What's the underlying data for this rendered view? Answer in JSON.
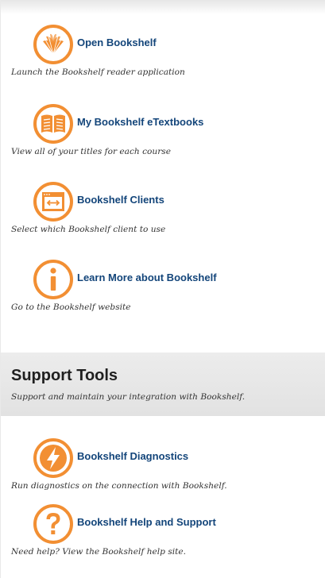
{
  "colors": {
    "icon_accent": "#f28f33",
    "link": "#13457a",
    "section_bg": "#e6e6e6"
  },
  "items": [
    {
      "icon": "book-open-icon",
      "title": "Open Bookshelf",
      "description": "Launch the Bookshelf reader application"
    },
    {
      "icon": "open-book-icon",
      "title": "My Bookshelf eTextbooks",
      "description": "View all of your titles for each course"
    },
    {
      "icon": "client-window-icon",
      "title": "Bookshelf Clients",
      "description": "Select which Bookshelf client to use"
    },
    {
      "icon": "info-icon",
      "title": "Learn More about Bookshelf",
      "description": "Go to the Bookshelf website"
    }
  ],
  "support": {
    "title": "Support Tools",
    "subtitle": "Support and maintain your integration with Bookshelf.",
    "items": [
      {
        "icon": "lightning-icon",
        "title": "Bookshelf Diagnostics",
        "description": "Run diagnostics on the connection with Bookshelf."
      },
      {
        "icon": "help-question-icon",
        "title": "Bookshelf Help and Support",
        "description": "Need help? View the Bookshelf help site."
      }
    ]
  }
}
